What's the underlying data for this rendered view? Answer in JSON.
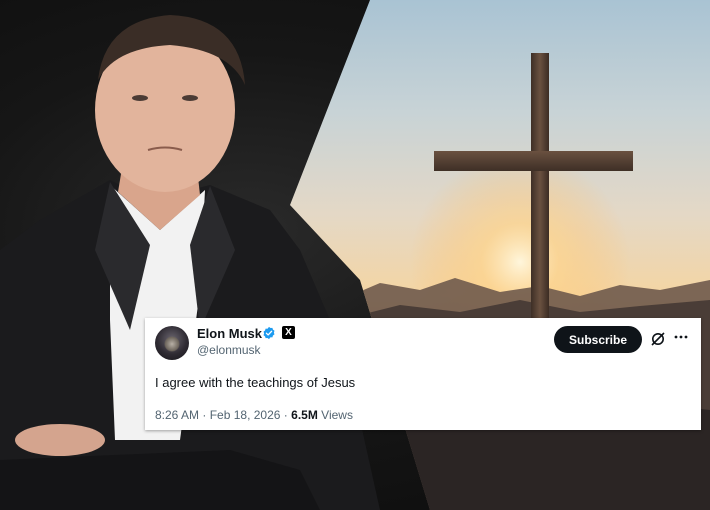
{
  "tweet": {
    "author_name": "Elon Musk",
    "handle": "@elonmusk",
    "subscribe_label": "Subscribe",
    "text": "I agree with the teachings of Jesus",
    "time": "8:26 AM",
    "date": "Feb 18, 2026",
    "views_count": "6.5M",
    "views_label": "Views",
    "verified_color": "#1d9bf0"
  },
  "icons": {
    "verified": "verified-badge-icon",
    "x_logo": "x-logo-icon",
    "grok": "grok-icon",
    "more": "more-icon"
  }
}
